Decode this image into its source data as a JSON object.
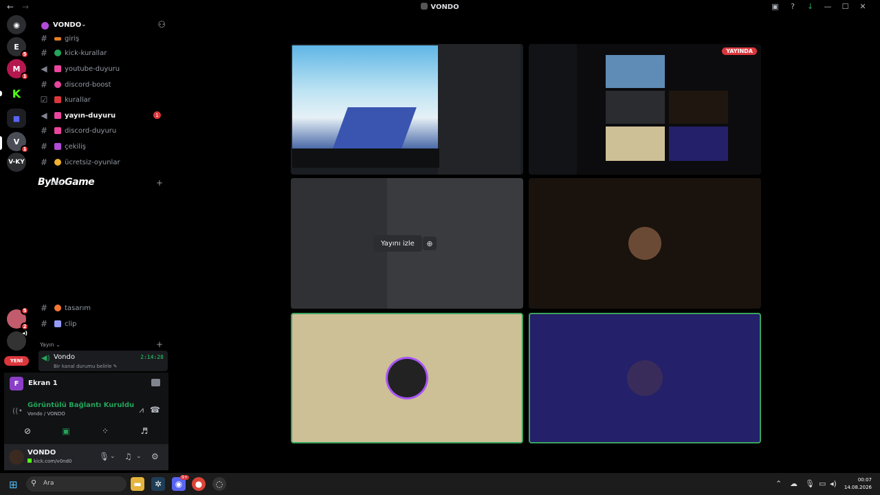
{
  "window": {
    "title": "VONDO",
    "nav_back": "←",
    "nav_forward": "→",
    "icons": {
      "inbox": "inbox-icon",
      "help": "?",
      "download": "↓",
      "minimize": "—",
      "maximize": "☐",
      "close": "✕"
    }
  },
  "rail": {
    "servers": [
      {
        "name": "discord-home",
        "glyph": "◉",
        "color": "#5865f2"
      },
      {
        "name": "server-e",
        "glyph": "E",
        "badge": "5",
        "color": "#2b2d31"
      },
      {
        "name": "server-m",
        "glyph": "M",
        "badge": "1",
        "color": "#b5184f"
      },
      {
        "name": "server-kick",
        "glyph": "K",
        "color": "#000000"
      },
      {
        "name": "server-folder",
        "glyph": "■",
        "color": "#3c3f91"
      },
      {
        "name": "server-v",
        "glyph": "V",
        "badge": "1",
        "color": "#4a4d55"
      },
      {
        "name": "server-vky",
        "glyph": "V-KY",
        "color": "#2b2d31"
      },
      {
        "name": "server-avatar-a",
        "glyph": "",
        "badge": "5",
        "color": "#c25b6b"
      },
      {
        "name": "server-avatar-b",
        "glyph": "",
        "badge": "2",
        "color": "#444"
      },
      {
        "name": "server-avatar-c",
        "glyph": "",
        "color": "#222"
      }
    ],
    "new_label": "YENİ",
    "new_badge": "1"
  },
  "server": {
    "name": "VONDO",
    "channels": [
      {
        "name": "giriş",
        "emoji_color": "#e67e22"
      },
      {
        "name": "kick-kurallar",
        "emoji_color": "#23a55a"
      },
      {
        "name": "youtube-duyuru",
        "emoji_color": "#eb459e"
      },
      {
        "name": "discord-boost",
        "emoji_color": "#eb459e"
      },
      {
        "name": "kurallar",
        "emoji_color": "#da373c"
      },
      {
        "name": "yayın-duyuru",
        "emoji_color": "#eb459e",
        "badge": "1",
        "active": true
      },
      {
        "name": "discord-duyuru",
        "emoji_color": "#eb459e"
      },
      {
        "name": "çekiliş",
        "emoji_color": "#b14bd8"
      },
      {
        "name": "ücretsiz-oyunlar",
        "emoji_color": "#f0b232"
      },
      {
        "name": "tasarım",
        "emoji_color": "#f57731"
      },
      {
        "name": "clip",
        "emoji_color": "#949cf7"
      }
    ],
    "categories": {
      "kick": "Kick",
      "yayin": "Yayın"
    },
    "watermark": "ByNoGame",
    "voice_user": {
      "name": "Vondo",
      "time": "2:14:28",
      "status": "Bir kanal durumu belirle"
    }
  },
  "panel": {
    "screen_avatar": "F",
    "screen_name": "Ekran 1",
    "connection_title": "Görüntülü Bağlantı Kuruldu",
    "connection_sub": "Vondo / VONDO",
    "user": {
      "name": "VONDO",
      "status": "kick.com/v0nd0"
    }
  },
  "stage": {
    "live_badge": "YAYINDA",
    "watch_label": "Yayını izle"
  },
  "taskbar": {
    "search_placeholder": "Ara",
    "discord_badge": "9+",
    "time": "00:07",
    "date": "14.08.2026"
  }
}
